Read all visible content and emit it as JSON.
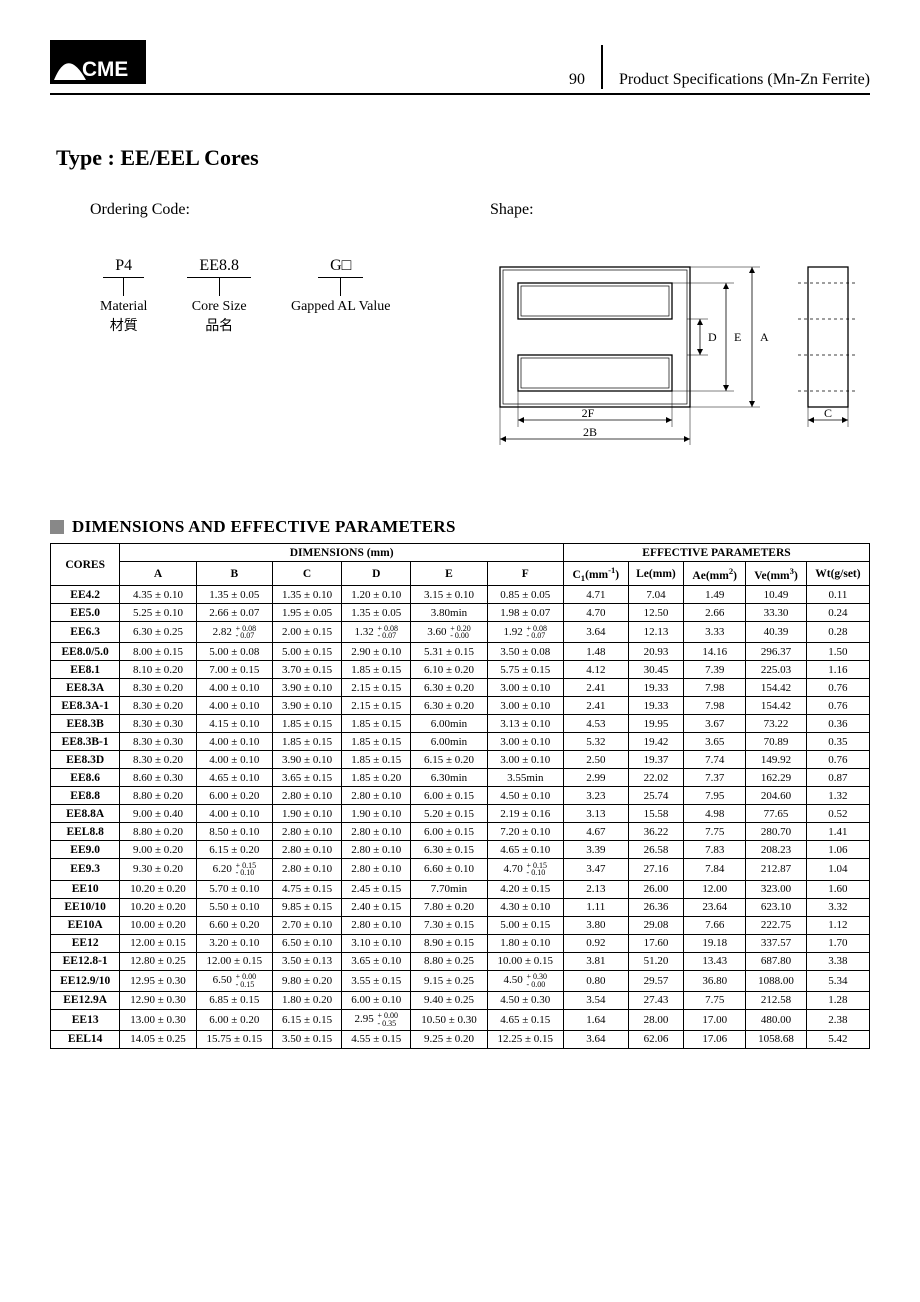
{
  "page_number": "90",
  "doc_title": "Product Specifications (Mn-Zn Ferrite)",
  "type_title": "Type : EE/EEL Cores",
  "ordering_label": "Ordering Code:",
  "shape_label": "Shape:",
  "ordering": {
    "c1": {
      "code": "P4",
      "label": "Material",
      "sub": "材質"
    },
    "c2": {
      "code": "EE8.8",
      "label": "Core Size",
      "sub": "品名"
    },
    "c3": {
      "code": "G□",
      "label": "Gapped AL Value",
      "sub": ""
    }
  },
  "shape_dims": {
    "D": "D",
    "E": "E",
    "A": "A",
    "F2": "2F",
    "B2": "2B",
    "C": "C"
  },
  "section_title": "DIMENSIONS AND EFFECTIVE PARAMETERS",
  "headers": {
    "cores": "CORES",
    "dims": "DIMENSIONS (mm)",
    "eff": "EFFECTIVE  PARAMETERS",
    "A": "A",
    "B": "B",
    "C": "C",
    "D": "D",
    "E": "E",
    "F": "F",
    "C1": "C",
    "C1_sub": "1",
    "C1_unit": "(mm",
    "C1_sup": "-1",
    "C1_end": ")",
    "Le": "Le(mm)",
    "Ae": "Ae(mm",
    "Ae_sup": "2",
    "Ae_end": ")",
    "Ve": "Ve(mm",
    "Ve_sup": "3",
    "Ve_end": ")",
    "Wt": "Wt(g/set)"
  },
  "rows": [
    {
      "name": "EE4.2",
      "A": "4.35 ± 0.10",
      "B": "1.35 ± 0.05",
      "C": "1.35 ± 0.10",
      "D": "1.20 ± 0.10",
      "E": "3.15 ± 0.10",
      "F": "0.85 ± 0.05",
      "C1": "4.71",
      "Le": "7.04",
      "Ae": "1.49",
      "Ve": "10.49",
      "Wt": "0.11"
    },
    {
      "name": "EE5.0",
      "A": "5.25 ± 0.10",
      "B": "2.66 ± 0.07",
      "C": "1.95 ± 0.05",
      "D": "1.35 ± 0.05",
      "E": "3.80min",
      "F": "1.98 ± 0.07",
      "C1": "4.70",
      "Le": "12.50",
      "Ae": "2.66",
      "Ve": "33.30",
      "Wt": "0.24"
    },
    {
      "name": "EE6.3",
      "A": "6.30 ± 0.25",
      "B": "2.82",
      "Btol": [
        "+ 0.08",
        "- 0.07"
      ],
      "C": "2.00 ± 0.15",
      "D": "1.32",
      "Dtol": [
        "+ 0.08",
        "- 0.07"
      ],
      "E": "3.60",
      "Etol": [
        "+ 0.20",
        "- 0.00"
      ],
      "F": "1.92",
      "Ftol": [
        "+ 0.08",
        "- 0.07"
      ],
      "C1": "3.64",
      "Le": "12.13",
      "Ae": "3.33",
      "Ve": "40.39",
      "Wt": "0.28"
    },
    {
      "name": "EE8.0/5.0",
      "A": "8.00 ± 0.15",
      "B": "5.00 ± 0.08",
      "C": "5.00 ± 0.15",
      "D": "2.90 ± 0.10",
      "E": "5.31 ± 0.15",
      "F": "3.50 ± 0.08",
      "C1": "1.48",
      "Le": "20.93",
      "Ae": "14.16",
      "Ve": "296.37",
      "Wt": "1.50"
    },
    {
      "name": "EE8.1",
      "A": "8.10 ± 0.20",
      "B": "7.00 ± 0.15",
      "C": "3.70 ± 0.15",
      "D": "1.85 ± 0.15",
      "E": "6.10 ± 0.20",
      "F": "5.75 ± 0.15",
      "C1": "4.12",
      "Le": "30.45",
      "Ae": "7.39",
      "Ve": "225.03",
      "Wt": "1.16"
    },
    {
      "name": "EE8.3A",
      "A": "8.30 ± 0.20",
      "B": "4.00 ± 0.10",
      "C": "3.90 ± 0.10",
      "D": "2.15 ± 0.15",
      "E": "6.30 ± 0.20",
      "F": "3.00 ± 0.10",
      "C1": "2.41",
      "Le": "19.33",
      "Ae": "7.98",
      "Ve": "154.42",
      "Wt": "0.76"
    },
    {
      "name": "EE8.3A-1",
      "A": "8.30 ± 0.20",
      "B": "4.00 ± 0.10",
      "C": "3.90 ± 0.10",
      "D": "2.15 ± 0.15",
      "E": "6.30 ± 0.20",
      "F": "3.00 ± 0.10",
      "C1": "2.41",
      "Le": "19.33",
      "Ae": "7.98",
      "Ve": "154.42",
      "Wt": "0.76"
    },
    {
      "name": "EE8.3B",
      "A": "8.30 ± 0.30",
      "B": "4.15 ± 0.10",
      "C": "1.85 ± 0.15",
      "D": "1.85 ± 0.15",
      "E": "6.00min",
      "F": "3.13 ± 0.10",
      "C1": "4.53",
      "Le": "19.95",
      "Ae": "3.67",
      "Ve": "73.22",
      "Wt": "0.36"
    },
    {
      "name": "EE8.3B-1",
      "A": "8.30 ± 0.30",
      "B": "4.00 ± 0.10",
      "C": "1.85 ± 0.15",
      "D": "1.85 ± 0.15",
      "E": "6.00min",
      "F": "3.00 ± 0.10",
      "C1": "5.32",
      "Le": "19.42",
      "Ae": "3.65",
      "Ve": "70.89",
      "Wt": "0.35"
    },
    {
      "name": "EE8.3D",
      "A": "8.30 ± 0.20",
      "B": "4.00 ± 0.10",
      "C": "3.90 ± 0.10",
      "D": "1.85 ± 0.15",
      "E": "6.15 ± 0.20",
      "F": "3.00 ± 0.10",
      "C1": "2.50",
      "Le": "19.37",
      "Ae": "7.74",
      "Ve": "149.92",
      "Wt": "0.76"
    },
    {
      "name": "EE8.6",
      "A": "8.60 ± 0.30",
      "B": "4.65 ± 0.10",
      "C": "3.65 ± 0.15",
      "D": "1.85 ± 0.20",
      "E": "6.30min",
      "F": "3.55min",
      "C1": "2.99",
      "Le": "22.02",
      "Ae": "7.37",
      "Ve": "162.29",
      "Wt": "0.87"
    },
    {
      "name": "EE8.8",
      "A": "8.80 ± 0.20",
      "B": "6.00 ± 0.20",
      "C": "2.80 ± 0.10",
      "D": "2.80 ± 0.10",
      "E": "6.00 ± 0.15",
      "F": "4.50 ± 0.10",
      "C1": "3.23",
      "Le": "25.74",
      "Ae": "7.95",
      "Ve": "204.60",
      "Wt": "1.32"
    },
    {
      "name": "EE8.8A",
      "A": "9.00 ± 0.40",
      "B": "4.00 ± 0.10",
      "C": "1.90 ± 0.10",
      "D": "1.90 ± 0.10",
      "E": "5.20 ± 0.15",
      "F": "2.19 ± 0.16",
      "C1": "3.13",
      "Le": "15.58",
      "Ae": "4.98",
      "Ve": "77.65",
      "Wt": "0.52"
    },
    {
      "name": "EEL8.8",
      "A": "8.80 ± 0.20",
      "B": "8.50 ± 0.10",
      "C": "2.80 ± 0.10",
      "D": "2.80 ± 0.10",
      "E": "6.00 ± 0.15",
      "F": "7.20 ± 0.10",
      "C1": "4.67",
      "Le": "36.22",
      "Ae": "7.75",
      "Ve": "280.70",
      "Wt": "1.41"
    },
    {
      "name": "EE9.0",
      "A": "9.00 ± 0.20",
      "B": "6.15 ± 0.20",
      "C": "2.80 ± 0.10",
      "D": "2.80 ± 0.10",
      "E": "6.30 ± 0.15",
      "F": "4.65 ± 0.10",
      "C1": "3.39",
      "Le": "26.58",
      "Ae": "7.83",
      "Ve": "208.23",
      "Wt": "1.06"
    },
    {
      "name": "EE9.3",
      "A": "9.30 ± 0.20",
      "B": "6.20",
      "Btol": [
        "+ 0.15",
        "- 0.10"
      ],
      "C": "2.80 ± 0.10",
      "D": "2.80 ± 0.10",
      "E": "6.60 ± 0.10",
      "F": "4.70",
      "Ftol": [
        "+ 0.15",
        "- 0.10"
      ],
      "C1": "3.47",
      "Le": "27.16",
      "Ae": "7.84",
      "Ve": "212.87",
      "Wt": "1.04"
    },
    {
      "name": "EE10",
      "A": "10.20 ± 0.20",
      "B": "5.70 ± 0.10",
      "C": "4.75 ± 0.15",
      "D": "2.45 ± 0.15",
      "E": "7.70min",
      "F": "4.20 ± 0.15",
      "C1": "2.13",
      "Le": "26.00",
      "Ae": "12.00",
      "Ve": "323.00",
      "Wt": "1.60"
    },
    {
      "name": "EE10/10",
      "A": "10.20 ± 0.20",
      "B": "5.50 ± 0.10",
      "C": "9.85 ± 0.15",
      "D": "2.40 ± 0.15",
      "E": "7.80 ± 0.20",
      "F": "4.30 ± 0.10",
      "C1": "1.11",
      "Le": "26.36",
      "Ae": "23.64",
      "Ve": "623.10",
      "Wt": "3.32"
    },
    {
      "name": "EE10A",
      "A": "10.00 ± 0.20",
      "B": "6.60 ± 0.20",
      "C": "2.70 ± 0.10",
      "D": "2.80 ± 0.10",
      "E": "7.30 ± 0.15",
      "F": "5.00 ± 0.15",
      "C1": "3.80",
      "Le": "29.08",
      "Ae": "7.66",
      "Ve": "222.75",
      "Wt": "1.12"
    },
    {
      "name": "EE12",
      "A": "12.00 ± 0.15",
      "B": "3.20 ± 0.10",
      "C": "6.50 ± 0.10",
      "D": "3.10 ± 0.10",
      "E": "8.90 ± 0.15",
      "F": "1.80 ± 0.10",
      "C1": "0.92",
      "Le": "17.60",
      "Ae": "19.18",
      "Ve": "337.57",
      "Wt": "1.70"
    },
    {
      "name": "EE12.8-1",
      "A": "12.80 ± 0.25",
      "B": "12.00 ± 0.15",
      "C": "3.50 ± 0.13",
      "D": "3.65 ± 0.10",
      "E": "8.80 ± 0.25",
      "F": "10.00 ± 0.15",
      "C1": "3.81",
      "Le": "51.20",
      "Ae": "13.43",
      "Ve": "687.80",
      "Wt": "3.38"
    },
    {
      "name": "EE12.9/10",
      "A": "12.95 ± 0.30",
      "B": "6.50",
      "Btol": [
        "+ 0.00",
        "- 0.15"
      ],
      "C": "9.80 ± 0.20",
      "D": "3.55 ± 0.15",
      "E": "9.15 ± 0.25",
      "F": "4.50",
      "Ftol": [
        "+ 0.30",
        "- 0.00"
      ],
      "C1": "0.80",
      "Le": "29.57",
      "Ae": "36.80",
      "Ve": "1088.00",
      "Wt": "5.34"
    },
    {
      "name": "EE12.9A",
      "A": "12.90 ± 0.30",
      "B": "6.85 ± 0.15",
      "C": "1.80 ± 0.20",
      "D": "6.00 ± 0.10",
      "E": "9.40 ± 0.25",
      "F": "4.50 ± 0.30",
      "C1": "3.54",
      "Le": "27.43",
      "Ae": "7.75",
      "Ve": "212.58",
      "Wt": "1.28"
    },
    {
      "name": "EE13",
      "A": "13.00 ± 0.30",
      "B": "6.00 ± 0.20",
      "C": "6.15 ± 0.15",
      "D": "2.95",
      "Dtol": [
        "+ 0.00",
        "- 0.35"
      ],
      "E": "10.50 ± 0.30",
      "F": "4.65 ± 0.15",
      "C1": "1.64",
      "Le": "28.00",
      "Ae": "17.00",
      "Ve": "480.00",
      "Wt": "2.38"
    },
    {
      "name": "EEL14",
      "A": "14.05 ± 0.25",
      "B": "15.75 ± 0.15",
      "C": "3.50 ± 0.15",
      "D": "4.55 ± 0.15",
      "E": "9.25 ± 0.20",
      "F": "12.25 ± 0.15",
      "C1": "3.64",
      "Le": "62.06",
      "Ae": "17.06",
      "Ve": "1058.68",
      "Wt": "5.42"
    }
  ]
}
